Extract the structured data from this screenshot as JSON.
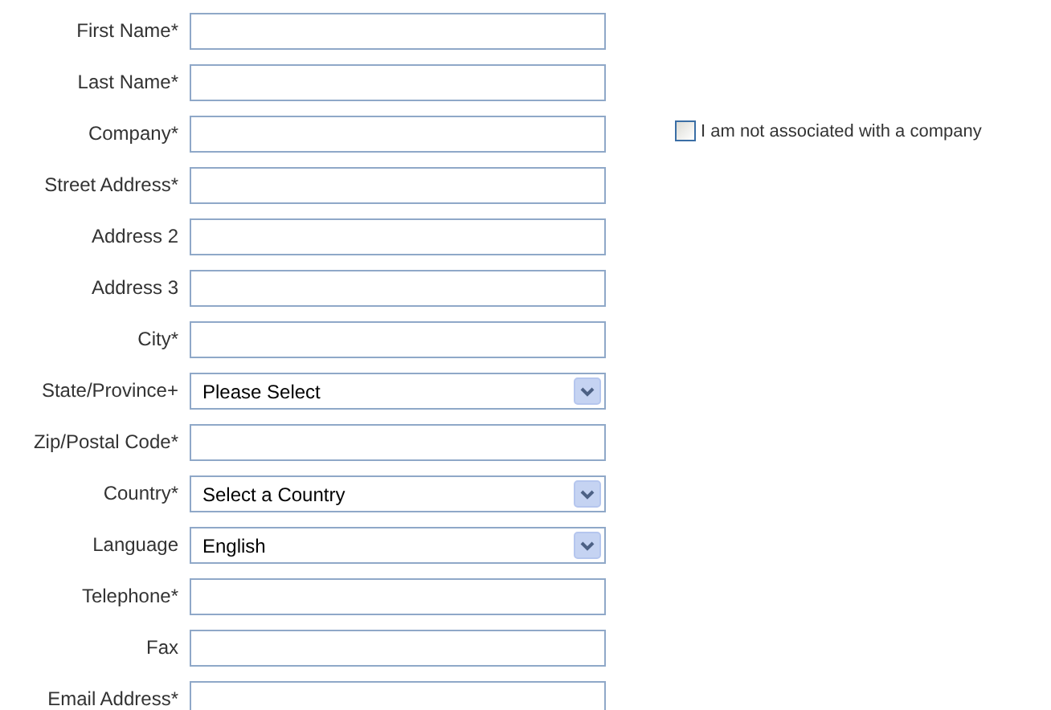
{
  "fields": [
    {
      "label": "First Name*",
      "kind": "text"
    },
    {
      "label": "Last Name*",
      "kind": "text"
    },
    {
      "label": "Company*",
      "kind": "text",
      "aside": {
        "label": "I am not associated with a company",
        "checked": false
      }
    },
    {
      "label": "Street Address*",
      "kind": "text"
    },
    {
      "label": "Address 2",
      "kind": "text"
    },
    {
      "label": "Address 3",
      "kind": "text"
    },
    {
      "label": "City*",
      "kind": "text"
    },
    {
      "label": "State/Province+",
      "kind": "select",
      "value": "Please Select"
    },
    {
      "label": "Zip/Postal Code*",
      "kind": "text"
    },
    {
      "label": "Country*",
      "kind": "select",
      "value": "Select a Country"
    },
    {
      "label": "Language",
      "kind": "select",
      "value": "English"
    },
    {
      "label": "Telephone*",
      "kind": "text"
    },
    {
      "label": "Fax",
      "kind": "text"
    },
    {
      "label": "Email Address*",
      "kind": "text"
    }
  ]
}
